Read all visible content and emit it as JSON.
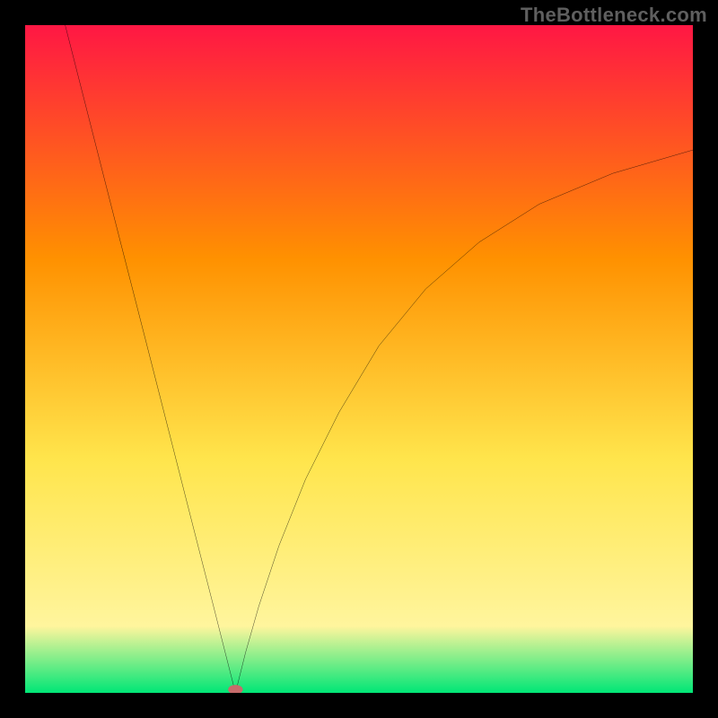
{
  "watermark": "TheBottleneck.com",
  "chart_data": {
    "type": "line",
    "title": "",
    "xlabel": "",
    "ylabel": "",
    "xlim": [
      0,
      100
    ],
    "ylim": [
      0,
      100
    ],
    "background_gradient": {
      "top": "#ff1744",
      "upper_mid": "#ff9100",
      "mid": "#ffe54c",
      "lower": "#fff59d",
      "bottom_band": "#00e676"
    },
    "minimum_marker": {
      "x": 31.5,
      "y": 0.5,
      "fill": "#c76b6b"
    },
    "series": [
      {
        "name": "curve",
        "stroke": "#000000",
        "stroke_width": 2,
        "x": [
          6,
          10,
          14,
          18,
          22,
          26,
          28,
          30,
          31.5,
          33,
          35,
          38,
          42,
          47,
          53,
          60,
          68,
          77,
          88,
          100
        ],
        "y": [
          100,
          84.3,
          68.6,
          53.0,
          37.3,
          21.6,
          13.8,
          5.9,
          0,
          6.0,
          13.0,
          22.0,
          32.0,
          42.0,
          52.0,
          60.5,
          67.5,
          73.2,
          77.8,
          81.3
        ]
      }
    ]
  }
}
